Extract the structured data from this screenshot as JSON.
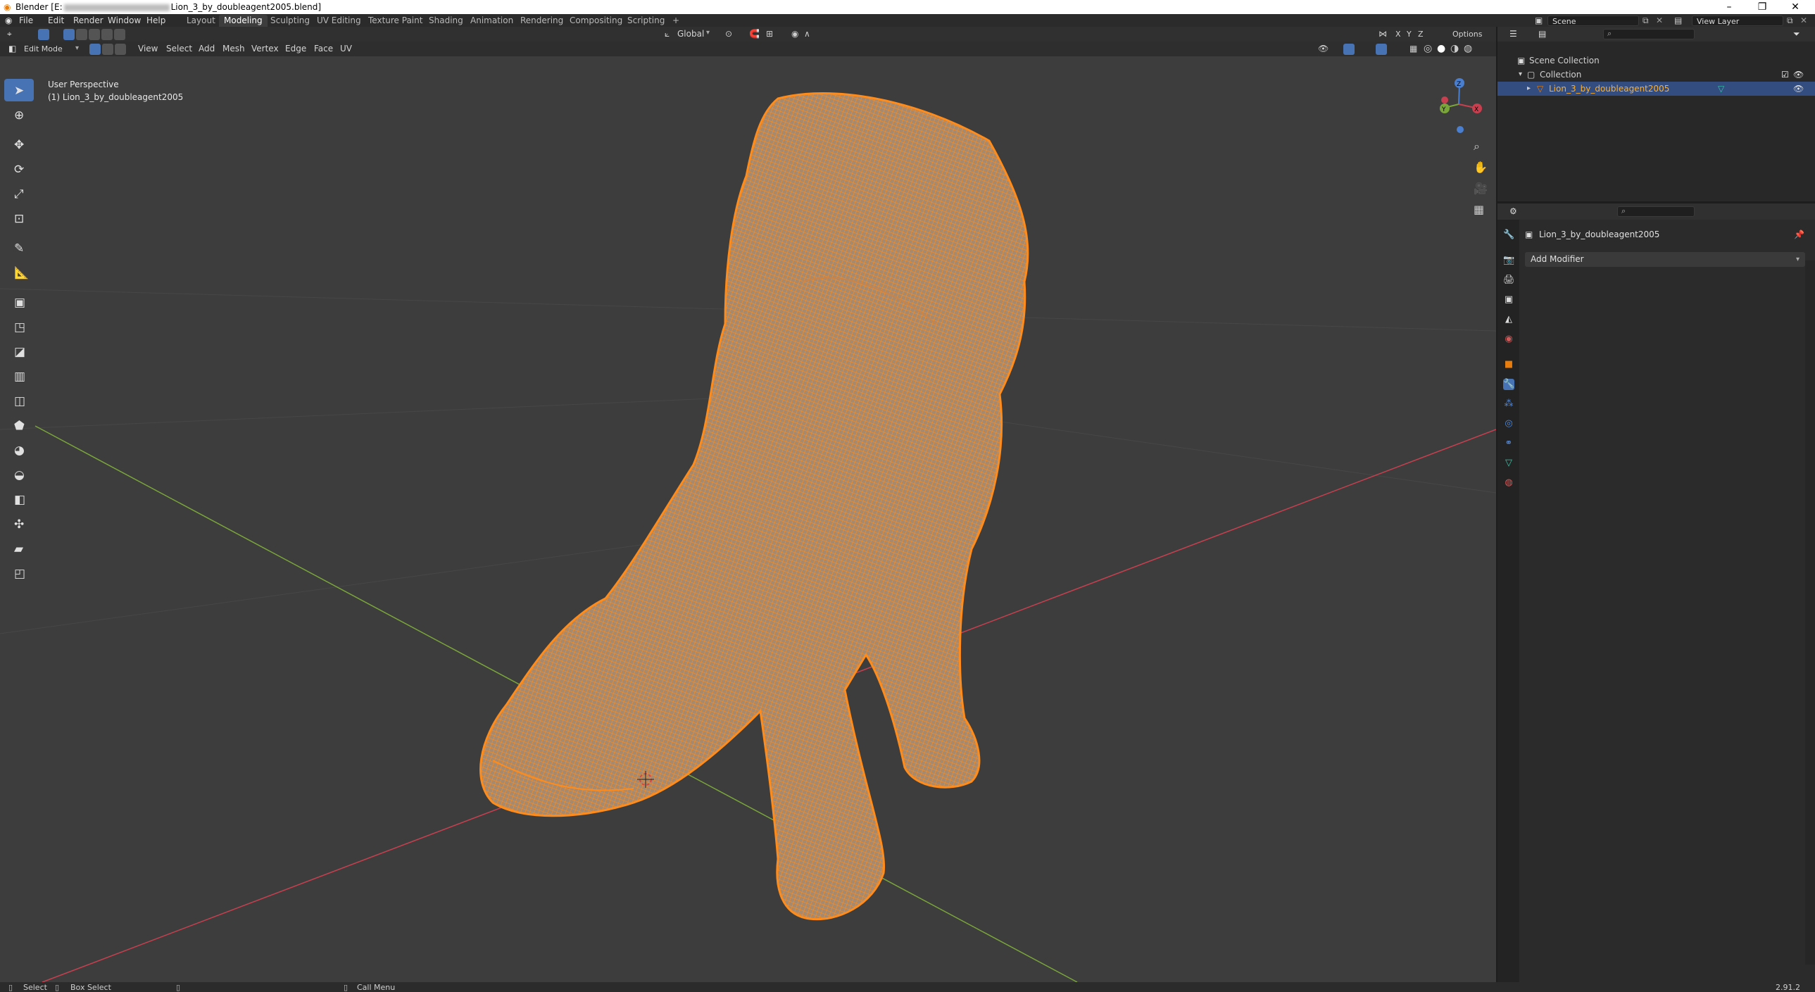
{
  "window": {
    "title_prefix": "Blender [E:",
    "title_suffix": "Lion_3_by_doubleagent2005.blend]",
    "minimize": "–",
    "restore": "❐",
    "close": "✕"
  },
  "topbar": {
    "menus": [
      "File",
      "Edit",
      "Render",
      "Window",
      "Help"
    ],
    "workspaces": [
      "Layout",
      "Modeling",
      "Sculpting",
      "UV Editing",
      "Texture Paint",
      "Shading",
      "Animation",
      "Rendering",
      "Compositing",
      "Scripting"
    ],
    "active_workspace": "Modeling",
    "add_workspace": "+",
    "scene": "Scene",
    "view_layer": "View Layer"
  },
  "header": {
    "transform_orientation": "Global",
    "options": "Options",
    "axes": [
      "X",
      "Y",
      "Z"
    ],
    "mode": "Edit Mode",
    "menus": [
      "View",
      "Select",
      "Add",
      "Mesh",
      "Vertex",
      "Edge",
      "Face",
      "UV"
    ]
  },
  "viewport": {
    "perspective": "User Perspective",
    "object_label": "(1) Lion_3_by_doubleagent2005",
    "gizmo_axes": [
      "X",
      "Y",
      "Z"
    ]
  },
  "outliner": {
    "scene_collection": "Scene Collection",
    "collection": "Collection",
    "object": "Lion_3_by_doubleagent2005"
  },
  "properties": {
    "object_name": "Lion_3_by_doubleagent2005",
    "add_modifier": "Add Modifier"
  },
  "statusbar": {
    "select": "Select",
    "box_select": "Box Select",
    "call_menu": "Call Menu",
    "version": "2.91.2"
  },
  "colors": {
    "mesh": "#ff8c1a",
    "active_blue": "#4772b3",
    "x_axis": "#c8404f",
    "y_axis": "#7aa53a"
  }
}
